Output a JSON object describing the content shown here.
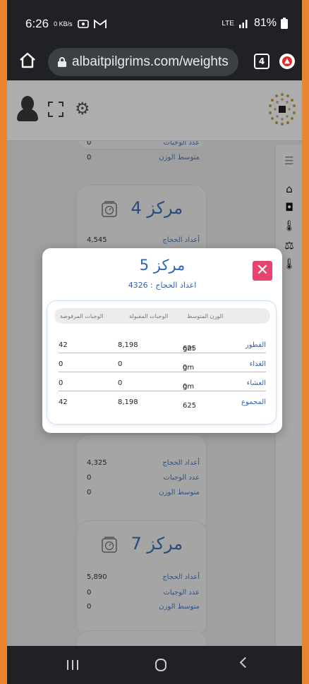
{
  "status": {
    "time": "6:26",
    "data_speed": "0 KB/s",
    "network": "LTE",
    "battery": "81%"
  },
  "browser": {
    "url": "albaitpilgrims.com/weights",
    "tab_count": "4"
  },
  "labels": {
    "pilgrims": "أعداد الحجاج",
    "meals": "عدد الوجبات",
    "avg_weight": "متوسط الوزن"
  },
  "card_top": {
    "meals_val": "0",
    "avg_val": "0"
  },
  "card4": {
    "title": "مركز 4",
    "pilgrims_val": "4,545"
  },
  "card6": {
    "pilgrims_val": "4,325",
    "meals_val": "0",
    "avg_val": "0"
  },
  "card7": {
    "title": "مركز 7",
    "pilgrims_val": "5,890",
    "meals_val": "0",
    "avg_val": "0"
  },
  "modal": {
    "title": "مركز 5",
    "subtitle": "اعداد الحجاج : 4326",
    "headers": {
      "rejected": "الوجبات المرفوضة",
      "accepted": "الوجبات المقبولة",
      "avg": "الوزن المتوسط"
    },
    "rows": [
      {
        "name": "الفطور",
        "rejected": "42",
        "accepted": "8,198",
        "avg": "625",
        "unit": "gm"
      },
      {
        "name": "الغداء",
        "rejected": "0",
        "accepted": "0",
        "avg": "0",
        "unit": "gm"
      },
      {
        "name": "العشاء",
        "rejected": "0",
        "accepted": "0",
        "avg": "0",
        "unit": "gm"
      },
      {
        "name": "المجموع",
        "rejected": "42",
        "accepted": "8,198",
        "avg": "625",
        "unit": ""
      }
    ],
    "close_label": "✕"
  },
  "colors": {
    "accent": "#3e6fb5",
    "close": "#e8436e",
    "frame": "#e9852f"
  }
}
